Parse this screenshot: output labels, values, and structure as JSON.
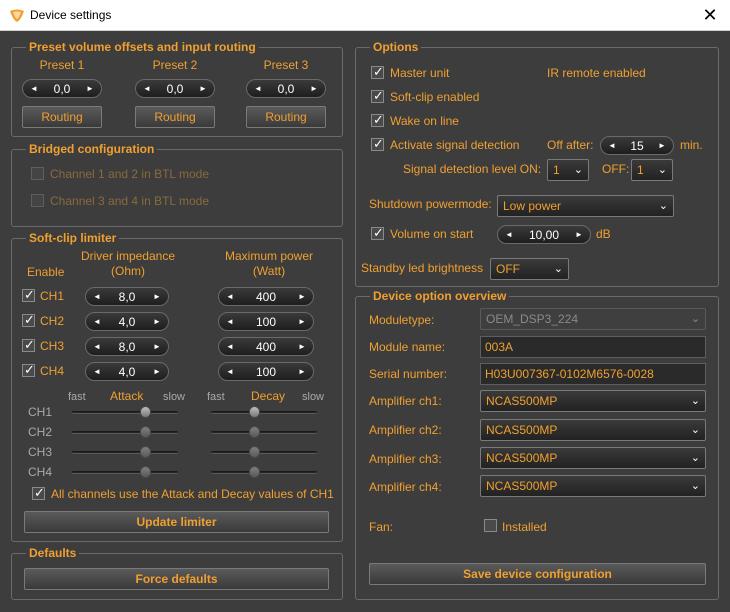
{
  "window": {
    "title": "Device settings",
    "close_glyph": "✕"
  },
  "preset": {
    "title": "Preset volume offsets and input routing",
    "items": [
      {
        "label": "Preset 1",
        "value": "0,0",
        "routing": "Routing"
      },
      {
        "label": "Preset 2",
        "value": "0,0",
        "routing": "Routing"
      },
      {
        "label": "Preset 3",
        "value": "0,0",
        "routing": "Routing"
      }
    ]
  },
  "bridged": {
    "title": "Bridged configuration",
    "ch12": "Channel 1 and 2 in BTL mode",
    "ch34": "Channel 3 and 4 in BTL mode"
  },
  "softclip": {
    "title": "Soft-clip limiter",
    "enable_label": "Enable",
    "impedance_label": "Driver impedance\n(Ohm)",
    "impedance_line1": "Driver impedance",
    "impedance_line2": "(Ohm)",
    "power_line1": "Maximum power",
    "power_line2": "(Watt)",
    "channels": [
      {
        "name": "CH1",
        "enabled": true,
        "impedance": "8,0",
        "power": "400"
      },
      {
        "name": "CH2",
        "enabled": true,
        "impedance": "4,0",
        "power": "100"
      },
      {
        "name": "CH3",
        "enabled": true,
        "impedance": "8,0",
        "power": "400"
      },
      {
        "name": "CH4",
        "enabled": true,
        "impedance": "4,0",
        "power": "100"
      }
    ],
    "attack_label": "Attack",
    "decay_label": "Decay",
    "fast": "fast",
    "slow": "slow",
    "sliders": [
      {
        "name": "CH1",
        "attack": 0.72,
        "decay": 0.4
      },
      {
        "name": "CH2",
        "attack": 0.72,
        "decay": 0.4
      },
      {
        "name": "CH3",
        "attack": 0.72,
        "decay": 0.4
      },
      {
        "name": "CH4",
        "attack": 0.72,
        "decay": 0.4
      }
    ],
    "all_channels_label": "All channels use the Attack and Decay values of CH1",
    "update_button": "Update limiter"
  },
  "defaults": {
    "title": "Defaults",
    "force_button": "Force defaults"
  },
  "options": {
    "title": "Options",
    "master_unit": "Master unit",
    "ir_remote": "IR remote enabled",
    "soft_clip": "Soft-clip enabled",
    "wake_on_line": "Wake on line",
    "activate_signal": "Activate signal detection",
    "off_after": "Off after:",
    "off_after_value": "15",
    "min": "min.",
    "level_on_label": "Signal detection level ON:",
    "level_on_value": "1",
    "level_off_label": "OFF:",
    "level_off_value": "1",
    "shutdown_label": "Shutdown powermode:",
    "shutdown_value": "Low power",
    "volume_on_start": "Volume on start",
    "volume_value": "10,00",
    "db": "dB",
    "standby_label": "Standby led brightness",
    "standby_value": "OFF"
  },
  "overview": {
    "title": "Device option overview",
    "moduletype_label": "Moduletype:",
    "moduletype_value": "OEM_DSP3_224",
    "module_name_label": "Module name:",
    "module_name_value": "003A",
    "serial_label": "Serial number:",
    "serial_value": "H03U007367-0102M6576-0028",
    "amps": [
      {
        "label": "Amplifier ch1:",
        "value": "NCAS500MP"
      },
      {
        "label": "Amplifier ch2:",
        "value": "NCAS500MP"
      },
      {
        "label": "Amplifier ch3:",
        "value": "NCAS500MP"
      },
      {
        "label": "Amplifier ch4:",
        "value": "NCAS500MP"
      }
    ],
    "fan_label": "Fan:",
    "installed_label": "Installed",
    "save_button": "Save device configuration"
  },
  "colors": {
    "accent": "#f0a030",
    "background": "#3d3d3d",
    "field": "#2a2a2a"
  },
  "icons": {
    "arrow_left": "◄",
    "arrow_right": "►",
    "check": "✓",
    "chevron": "⌄"
  }
}
